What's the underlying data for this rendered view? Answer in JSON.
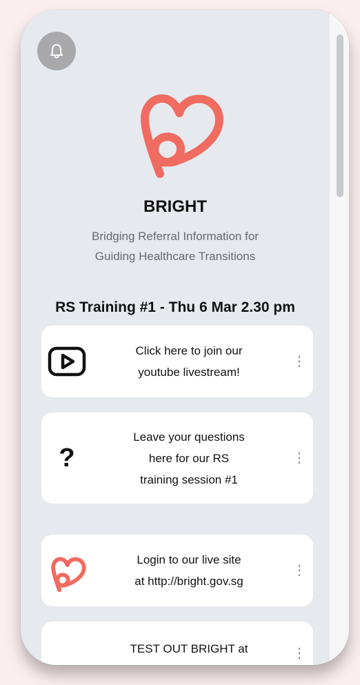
{
  "brand": {
    "title": "BRIGHT",
    "subtitle_line1": "Bridging Referral Information for",
    "subtitle_line2": "Guiding Healthcare Transitions"
  },
  "session_title": "RS Training #1 - Thu 6 Mar 2.30 pm",
  "icons": {
    "notification": "bell-icon",
    "logo": "heart-logo",
    "more": "vertical-ellipsis-icon"
  },
  "colors": {
    "accent": "#f06b60",
    "background": "#e6e9ee",
    "card": "#ffffff"
  },
  "cards": [
    {
      "icon": "youtube-play-icon",
      "line1": "Click here to join our",
      "line2": "youtube livestream!",
      "more": "⋮"
    },
    {
      "icon": "question-mark-icon",
      "glyph": "?",
      "line1": "Leave your questions",
      "line2": "here for our RS",
      "line3": "training session #1",
      "more": "⋮"
    },
    {
      "icon": "bright-heart-icon",
      "line1": "Login to our live site",
      "line2": "at http://bright.gov.sg",
      "more": "⋮"
    },
    {
      "icon": "none",
      "line1": "TEST OUT BRIGHT at",
      "more": "⋮"
    }
  ]
}
